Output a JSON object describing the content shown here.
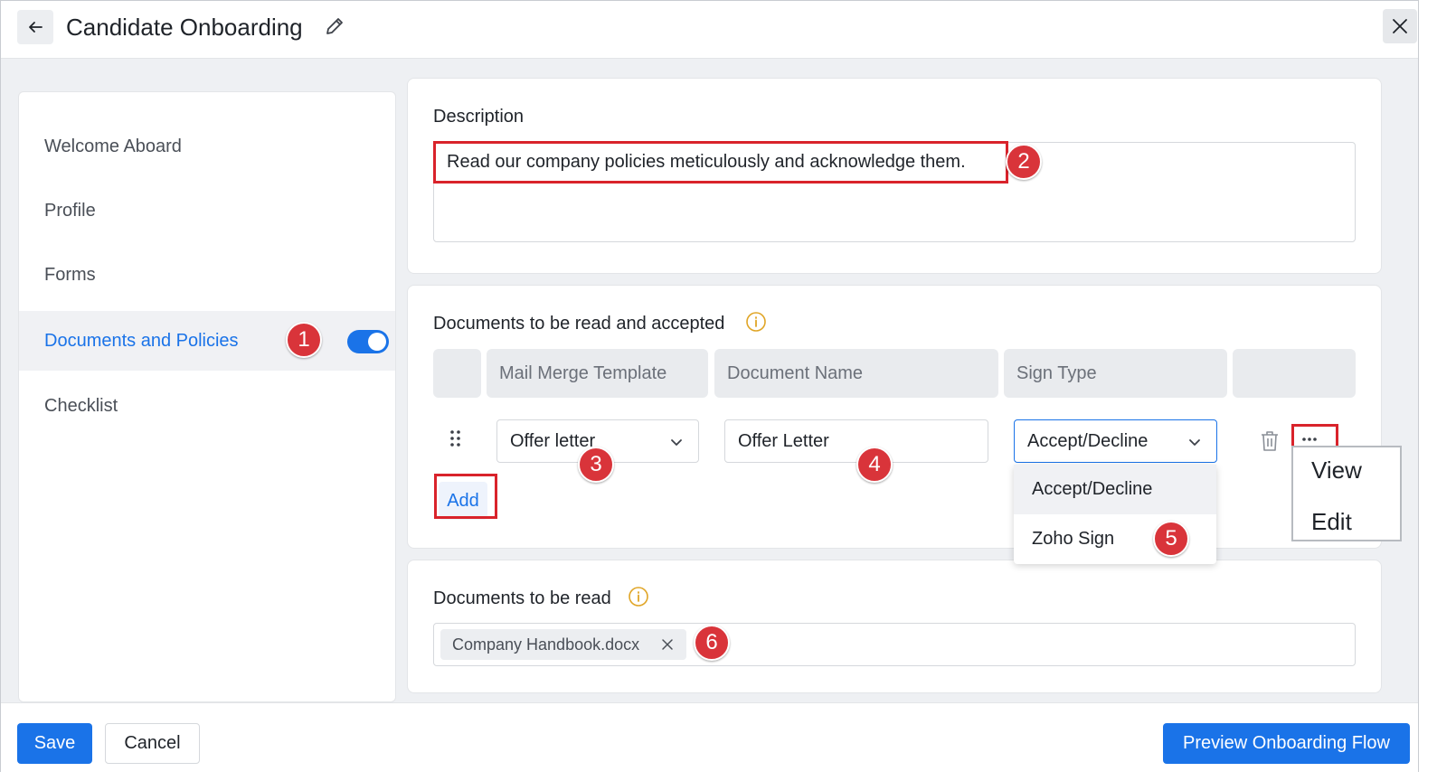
{
  "header": {
    "title": "Candidate Onboarding"
  },
  "sidebar": {
    "items": [
      {
        "label": "Welcome Aboard"
      },
      {
        "label": "Profile"
      },
      {
        "label": "Forms"
      },
      {
        "label": "Documents and Policies",
        "active": true,
        "toggle_on": true
      },
      {
        "label": "Checklist"
      }
    ]
  },
  "description": {
    "label": "Description",
    "value": "Read our company policies meticulously and acknowledge them."
  },
  "documents_accept": {
    "label": "Documents to be read and accepted",
    "columns": [
      "Mail Merge Template",
      "Document Name",
      "Sign Type"
    ],
    "row": {
      "template": "Offer letter",
      "document_name": "Offer Letter",
      "sign_type": "Accept/Decline"
    },
    "add_label": "Add",
    "sign_type_options": [
      "Accept/Decline",
      "Zoho Sign"
    ],
    "more_menu": [
      "View",
      "Edit"
    ]
  },
  "documents_read": {
    "label": "Documents to be read",
    "chips": [
      "Company Handbook.docx"
    ]
  },
  "annotations": [
    "1",
    "2",
    "3",
    "4",
    "5",
    "6"
  ],
  "footer": {
    "save": "Save",
    "cancel": "Cancel",
    "preview": "Preview Onboarding Flow"
  },
  "colors": {
    "accent": "#1a73e8",
    "annotation_red": "#d9343a",
    "info_icon": "#e0a526"
  }
}
